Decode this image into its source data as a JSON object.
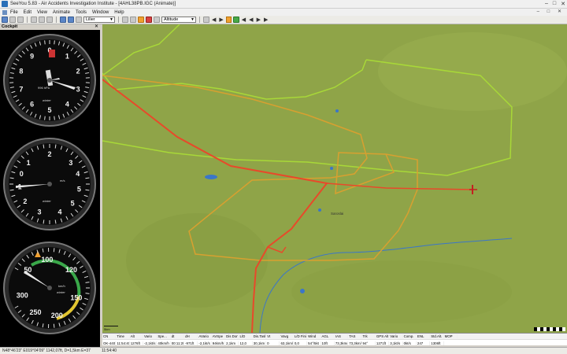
{
  "window": {
    "title": "SeeYou 5.83 - Air Accidents Investigation Institute - [4AHL38PB.IGC (Animate)]",
    "minimize": "–",
    "maximize": "□",
    "close": "✕"
  },
  "menu": {
    "items": [
      "File",
      "Edit",
      "View",
      "Animate",
      "Tools",
      "Window",
      "Help"
    ],
    "mdi": "– □ ✕"
  },
  "toolbar": {
    "zoom_value": "Lilier",
    "view_mode": "Altitude",
    "play_controls": [
      "◀",
      "▶",
      "◀",
      "◀",
      "▶",
      "▶"
    ]
  },
  "cockpit": {
    "title": "Cockpit",
    "close": "✕",
    "altimeter": {
      "labels": [
        "0",
        "1",
        "2",
        "3",
        "4",
        "5",
        "6",
        "7",
        "8",
        "9"
      ],
      "kollsman": "996 hPa",
      "brand": "winter"
    },
    "vario": {
      "labels": [
        "1",
        "2",
        "3",
        "4",
        "5",
        "5",
        "4",
        "3",
        "2",
        "1",
        "0"
      ],
      "unit": "m/s",
      "brand": "winter"
    },
    "asi": {
      "labels": [
        "50",
        "100",
        "120",
        "150",
        "200",
        "250",
        "300"
      ],
      "unit": "km/h",
      "brand": "winter"
    }
  },
  "map": {
    "scale_label": "5km",
    "place_label": "Saroslai",
    "colors": {
      "track": "#e8492a",
      "task_yellow": "#d8a030",
      "task_green": "#a8d838",
      "water": "#3b76c8",
      "terrain": "#8fa448"
    }
  },
  "table": {
    "headers": [
      "CN",
      "Time",
      "Alt",
      "Vario",
      "Spe...",
      "dt",
      "dH",
      "AVario",
      "AVSpe",
      "Dis Done",
      "L/D",
      "Dis.Task",
      "Vt",
      "Vavg",
      "L/D Finish",
      "Wind",
      "AGL",
      "IAS",
      "TAS",
      "Trk",
      "GPS Alt",
      "Vario",
      "Comp.",
      "ENL",
      "Std.Alt.",
      "MOP"
    ],
    "values": [
      "OK-4406",
      "11:54:40",
      "1276ft",
      "-2,1kt/s",
      "40km/h",
      "00:11:20",
      "-971ft",
      "-2,1kt/s",
      "94km/h",
      "2,1km",
      "12,0",
      "30,1km",
      "0",
      "63,1km/h",
      "0,0",
      "54°/5kt",
      "10ft",
      "73,3km/h",
      "73,3km/h",
      "94°",
      "1271ft",
      "3,1kt/s",
      "0kt/s",
      "247",
      "1306ft",
      ""
    ]
  },
  "status": {
    "coords": "N48°46'23\" E019°04'09\" 1142,07ft, D=1,5km E=37",
    "time": "11:54:40"
  }
}
